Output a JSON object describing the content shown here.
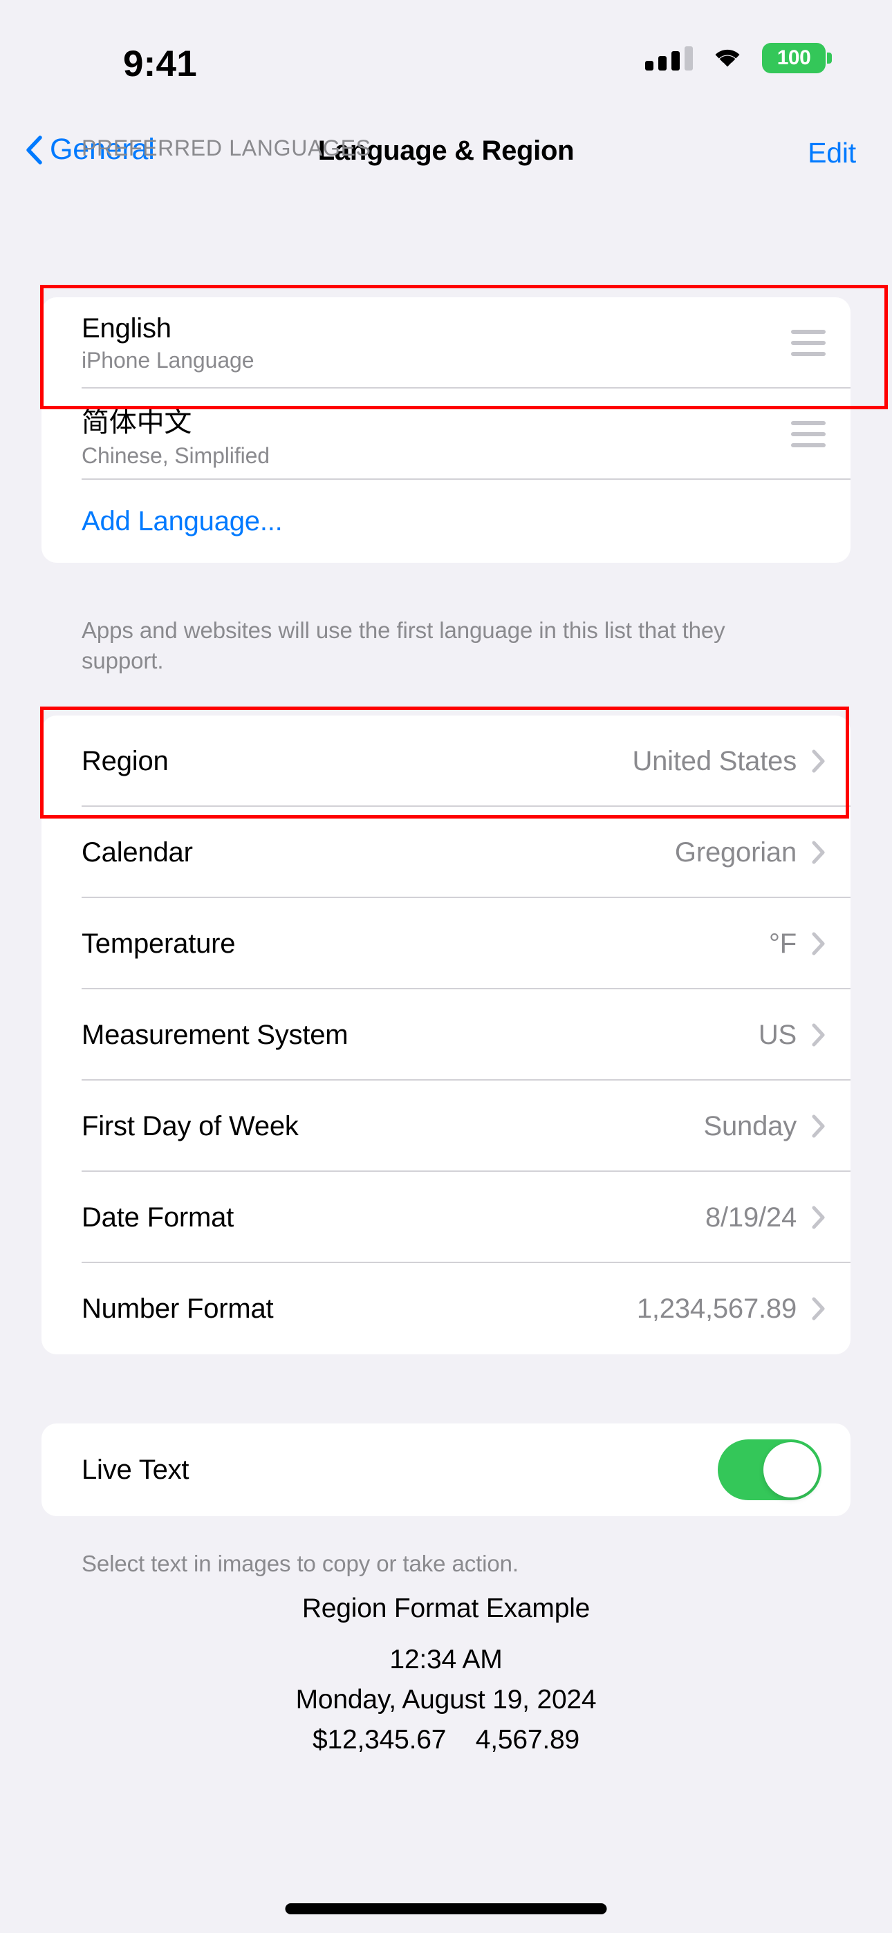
{
  "status_bar": {
    "time": "9:41",
    "cellular_icon": "cellular-signal-icon",
    "cellular_bars_filled": 3,
    "cellular_bars_total": 4,
    "wifi_icon": "wifi-icon",
    "battery_percent": "100",
    "battery_color": "#34C759"
  },
  "nav": {
    "back_icon": "chevron-left-icon",
    "back_label": "General",
    "title": "Language & Region",
    "edit_label": "Edit",
    "accent_color": "#007AFF"
  },
  "languages_section": {
    "header": "PREFERRED LANGUAGES",
    "items": [
      {
        "name": "English",
        "subtitle": "iPhone Language",
        "reorder_icon": "drag-handle-icon"
      },
      {
        "name": "简体中文",
        "subtitle": "Chinese, Simplified",
        "reorder_icon": "drag-handle-icon"
      }
    ],
    "add_language_label": "Add Language...",
    "footer": "Apps and websites will use the first language in this list that they support."
  },
  "region_section": {
    "rows": [
      {
        "label": "Region",
        "value": "United States",
        "chevron_icon": "chevron-right-icon"
      },
      {
        "label": "Calendar",
        "value": "Gregorian",
        "chevron_icon": "chevron-right-icon"
      },
      {
        "label": "Temperature",
        "value": "°F",
        "chevron_icon": "chevron-right-icon"
      },
      {
        "label": "Measurement System",
        "value": "US",
        "chevron_icon": "chevron-right-icon"
      },
      {
        "label": "First Day of Week",
        "value": "Sunday",
        "chevron_icon": "chevron-right-icon"
      },
      {
        "label": "Date Format",
        "value": "8/19/24",
        "chevron_icon": "chevron-right-icon"
      },
      {
        "label": "Number Format",
        "value": "1,234,567.89",
        "chevron_icon": "chevron-right-icon"
      }
    ]
  },
  "live_text_section": {
    "label": "Live Text",
    "enabled": true,
    "toggle_color": "#34C759",
    "footer": "Select text in images to copy or take action."
  },
  "region_format_example": {
    "title": "Region Format Example",
    "time": "12:34 AM",
    "date": "Monday, August 19, 2024",
    "numbers": "$12,345.67    4,567.89"
  },
  "annotations": {
    "highlight_color": "#FF0000",
    "boxes": [
      {
        "target": "english-language-row"
      },
      {
        "target": "region-row"
      }
    ]
  },
  "home_indicator": "home-indicator"
}
